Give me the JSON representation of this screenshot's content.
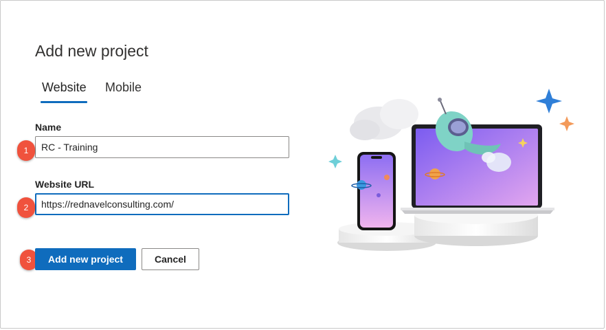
{
  "dialog": {
    "title": "Add new project",
    "tabs": [
      {
        "label": "Website",
        "active": true
      },
      {
        "label": "Mobile",
        "active": false
      }
    ],
    "fields": {
      "name": {
        "label": "Name",
        "value": "RC - Training"
      },
      "url": {
        "label": "Website URL",
        "value": "https://rednavelconsulting.com/"
      }
    },
    "steps": [
      "1",
      "2",
      "3"
    ],
    "buttons": {
      "primary": "Add new project",
      "cancel": "Cancel"
    }
  },
  "colors": {
    "accent": "#0f6cbd",
    "step_badge": "#f0523d"
  },
  "illustration": {
    "icons": [
      "cloud-icon",
      "phone-icon",
      "laptop-icon",
      "rocket-icon",
      "sparkle-icon",
      "planet-icon"
    ]
  }
}
